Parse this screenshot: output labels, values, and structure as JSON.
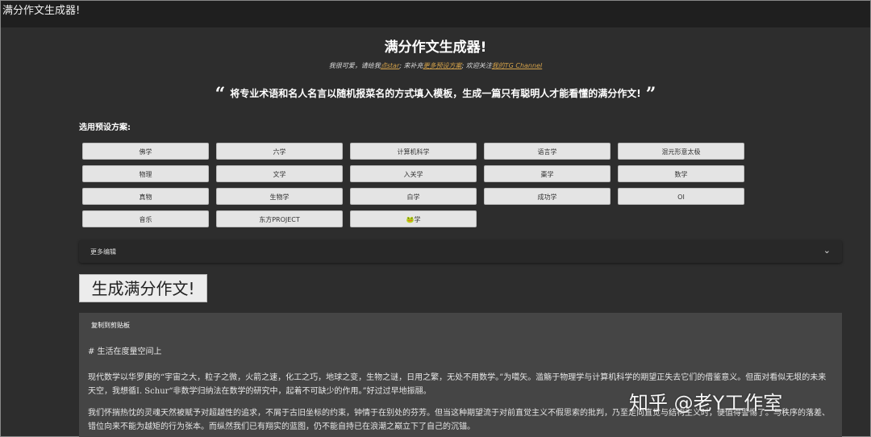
{
  "window": {
    "title": "满分作文生成器!"
  },
  "header": {
    "title": "满分作文生成器!",
    "subtitle_parts": [
      "我很可爱，请给我",
      "点star",
      "; 来补充",
      "更多预设方案",
      "; 欢迎关注",
      "我的TG Channel"
    ],
    "quote_open": "“",
    "quote_text": "将专业术语和名人名言以随机报菜名的方式填入模板，生成一篇只有聪明人才能看懂的满分作文!",
    "quote_close": "”"
  },
  "presets": {
    "label": "选用预设方案:",
    "items": [
      "佛学",
      "六学",
      "计算机科学",
      "语言学",
      "混元形意太极",
      "物理",
      "文学",
      "入关学",
      "棗学",
      "数学",
      "真物",
      "生物学",
      "白学",
      "成功学",
      "OI",
      "音乐",
      "东方PROJECT",
      "🐸学"
    ]
  },
  "more_edit": {
    "label": "更多编辑",
    "chevron": "⌄"
  },
  "generate_button": "生成满分作文!",
  "output": {
    "copy_label": "复制到剪贴板",
    "heading": "# 生活在度量空间上",
    "para1": "现代数学以华罗庚的“宇宙之大，粒子之微，火箭之速，化工之巧，地球之变，生物之谜，日用之繁，无处不用数学。”为嚆矢。滥觞于物理学与计算机科学的期望正失去它们的借鉴意义。但面对看似无垠的未来天空，我想循I. Schur“非数学归纳法在数学的研究中，起着不可缺少的作用。”好过过早地振翮。",
    "para2": "我们怀揣热忱的灵魂天然被赋予对超越性的追求，不屑于古旧坐标的约束，钟情于在别处的芬芳。但当这种期望流于对前直觉主义不假思索的批判，乃至走向直觉与结构主义时，便值得警惕了。与秩序的落差、错位向来不能为越矩的行为张本。而纵然我们已有翔实的蓝图，仍不能自持已在浪潮之巅立下了自己的沉锚。"
  },
  "watermark": "知乎 @老Y工作室"
}
